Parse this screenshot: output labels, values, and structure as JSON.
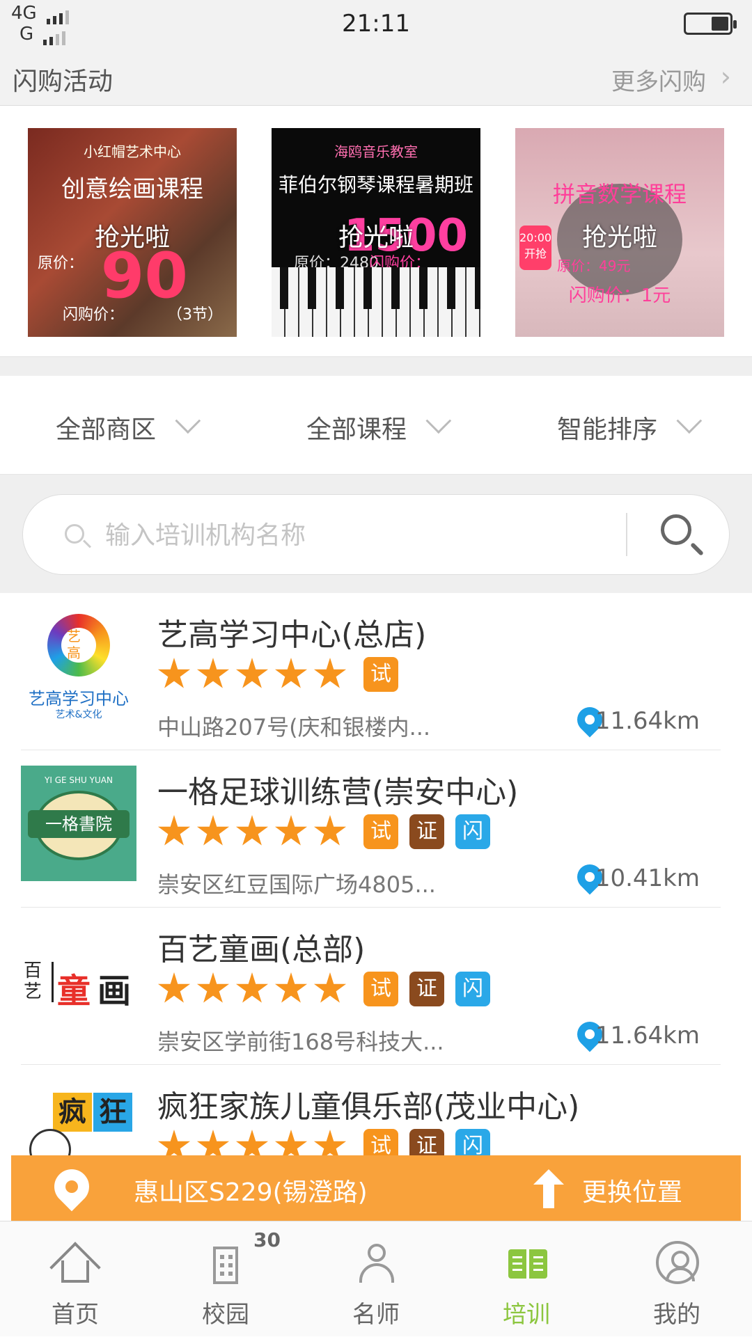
{
  "status_bar": {
    "network_top": "4G",
    "network_bottom": "G",
    "time": "21:11"
  },
  "flash": {
    "title": "闪购活动",
    "more": "更多闪购",
    "banners": [
      {
        "overlay": "抢光啦",
        "top": "小红帽艺术中心",
        "headline": "创意绘画课程",
        "original_price": "原价：",
        "flash_price": "闪购价：",
        "price": "90",
        "note": "（3节）"
      },
      {
        "overlay": "抢光啦",
        "top": "海鸥音乐教室",
        "headline": "菲伯尔钢琴课程暑期班",
        "original_price": "原价：2480",
        "flash_price": "闪购价：",
        "price": "1500"
      },
      {
        "overlay": "抢光啦",
        "headline": "拼音数学课程",
        "badge": "20:00 开抢",
        "original_price": "原价：49元",
        "flash_price": "闪购价：1元"
      }
    ]
  },
  "filters": {
    "area": "全部商区",
    "course": "全部课程",
    "sort": "智能排序"
  },
  "search": {
    "placeholder": "输入培训机构名称"
  },
  "schools": [
    {
      "name": "艺高学习中心(总店)",
      "stars": 5,
      "tags": [
        "试"
      ],
      "address": "中山路207号(庆和银楼内...",
      "distance": "11.64km",
      "logo_caption": "艺高学习中心",
      "logo_sub": "艺术&文化",
      "logo_mark": "艺高"
    },
    {
      "name": "一格足球训练营(崇安中心)",
      "stars": 5,
      "tags": [
        "试",
        "证",
        "闪"
      ],
      "address": "崇安区红豆国际广场4805...",
      "distance": "10.41km",
      "logo_top": "YI GE SHU YUAN",
      "logo_ribbon": "一格書院"
    },
    {
      "name": "百艺童画(总部)",
      "stars": 5,
      "tags": [
        "试",
        "证",
        "闪"
      ],
      "address": "崇安区学前街168号科技大...",
      "distance": "11.64km",
      "logo_a": "百艺",
      "logo_b": "童",
      "logo_c": "画"
    },
    {
      "name": "疯狂家族儿童俱乐部(茂业中心)",
      "stars": 5,
      "tags": [
        "试",
        "证",
        "闪"
      ],
      "logo_a": "疯",
      "logo_b": "狂"
    }
  ],
  "location": {
    "current": "惠山区S229(锡澄路)",
    "change": "更换位置"
  },
  "tabs": [
    {
      "label": "首页",
      "icon": "home-icon"
    },
    {
      "label": "校园",
      "icon": "campus-icon",
      "badge": "30"
    },
    {
      "label": "名师",
      "icon": "teacher-icon"
    },
    {
      "label": "培训",
      "icon": "training-icon",
      "active": true
    },
    {
      "label": "我的",
      "icon": "profile-icon"
    }
  ],
  "colors": {
    "accent_orange": "#f7941d",
    "cert_brown": "#8a4a1e",
    "flash_blue": "#2aa8e8",
    "tab_active_green": "#8cc63f",
    "location_bar": "#f9a23b"
  }
}
